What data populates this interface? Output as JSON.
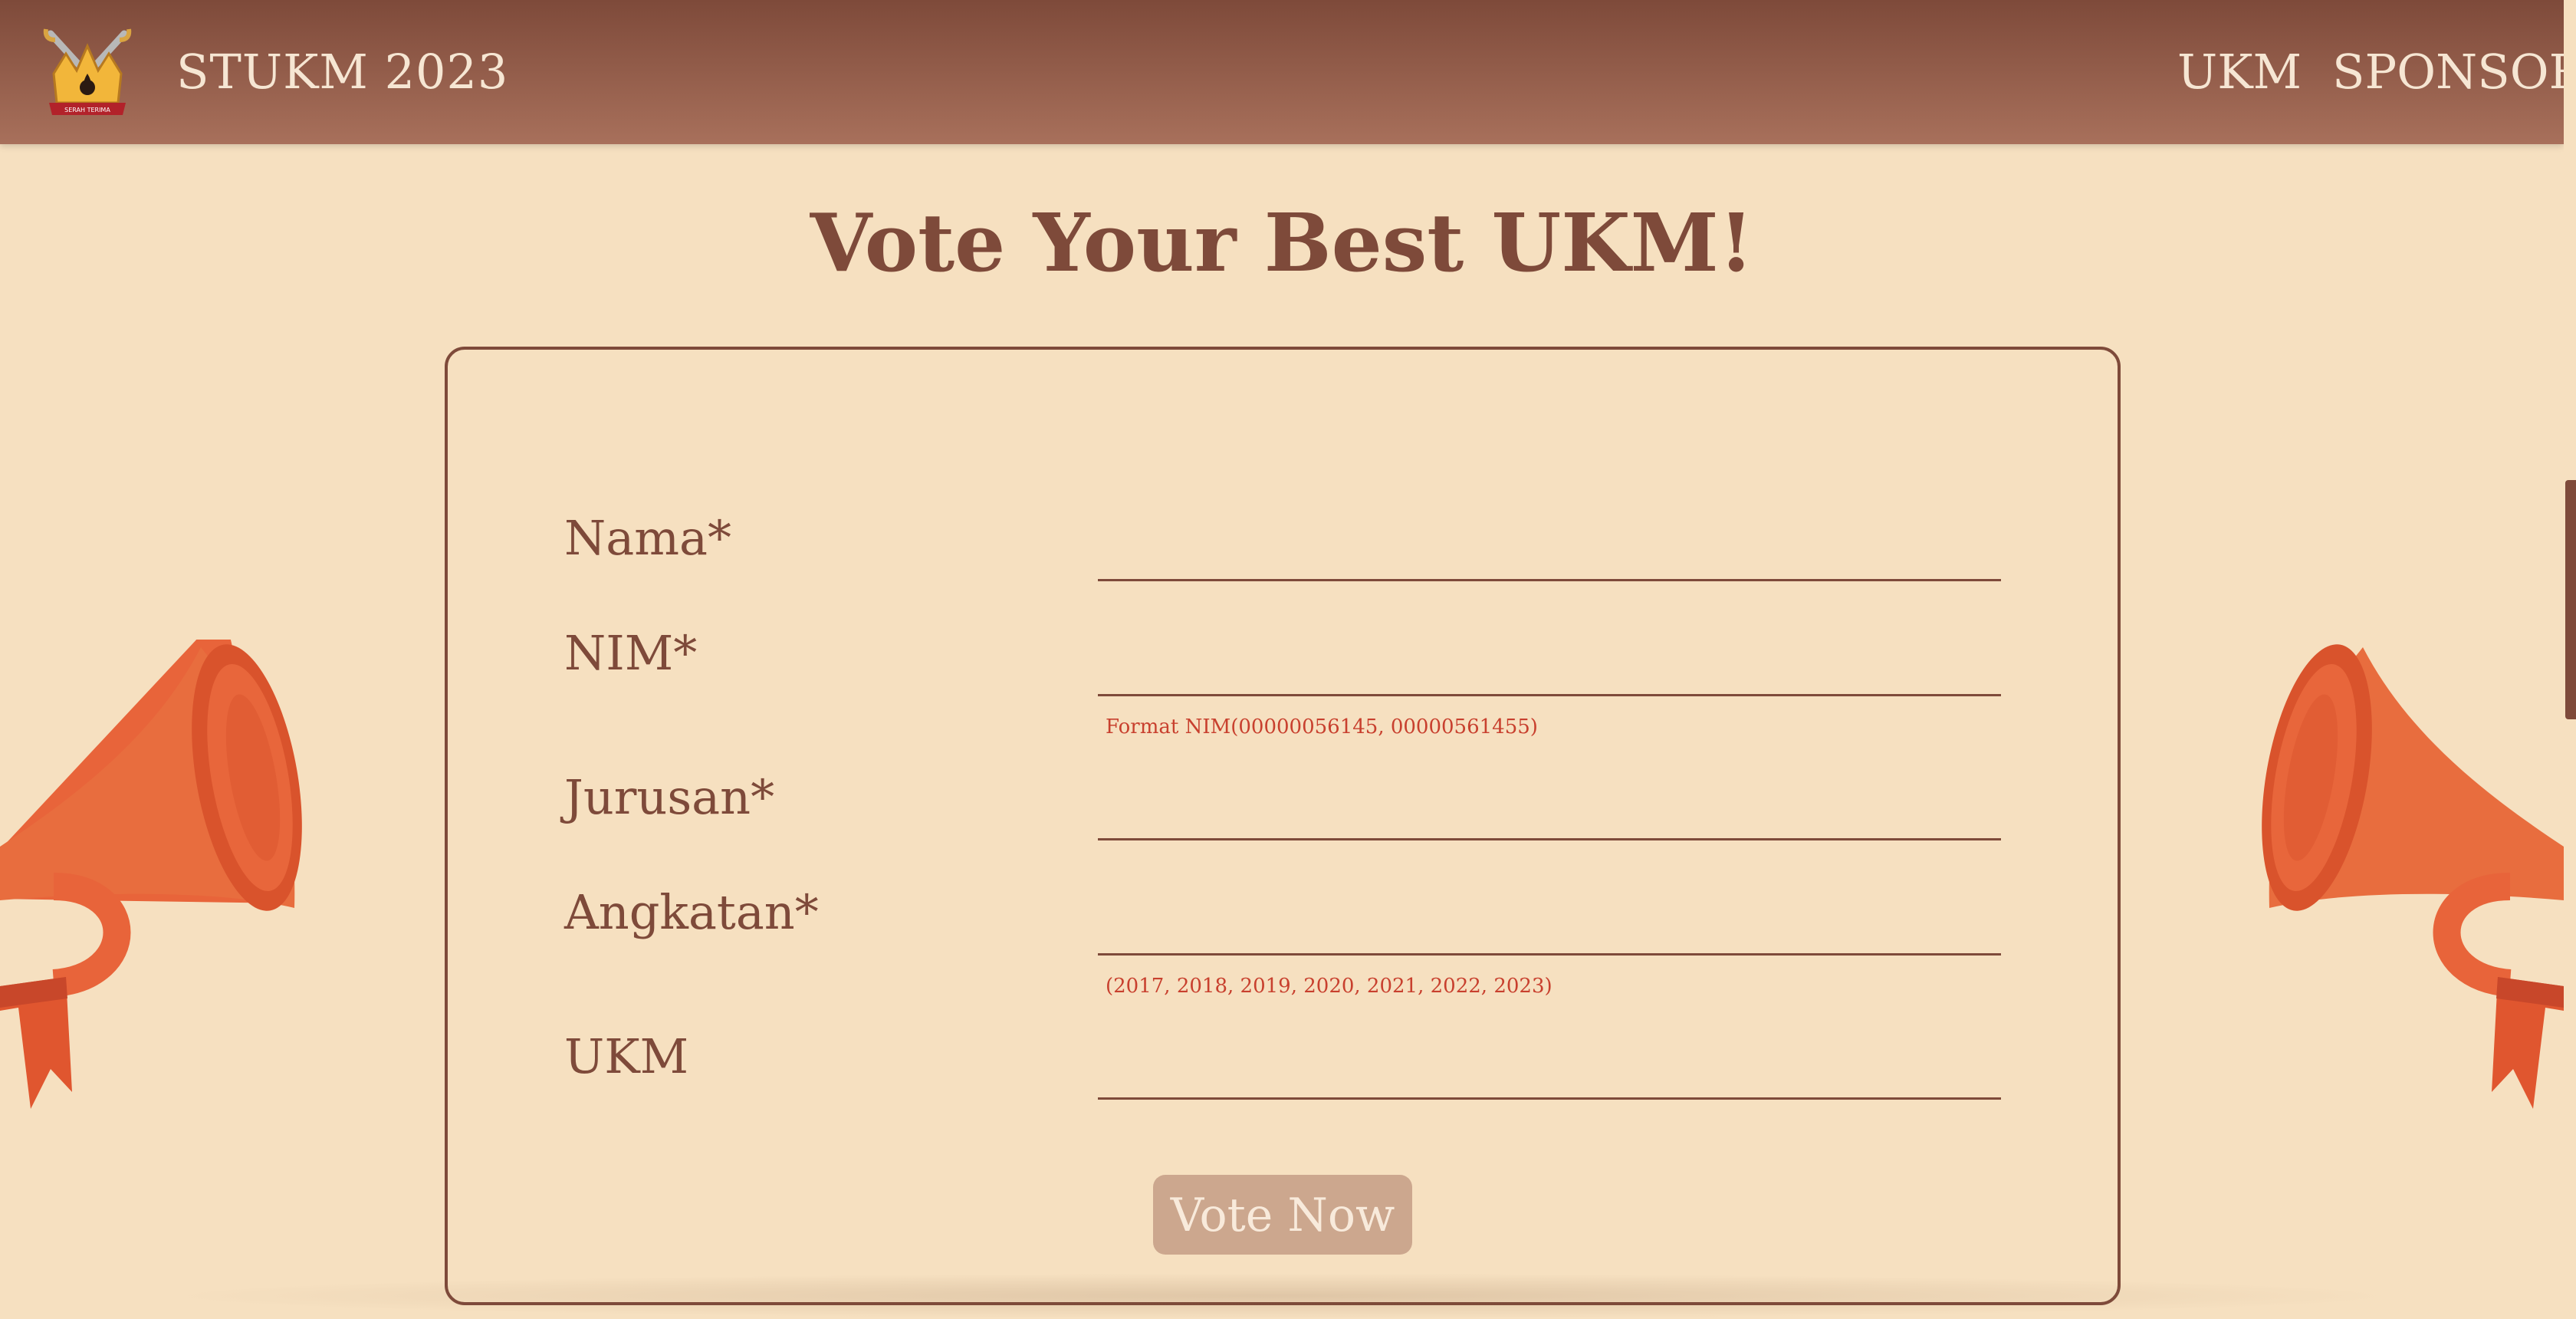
{
  "header": {
    "brand": "STUKM 2023",
    "nav": [
      {
        "label": "UKM"
      },
      {
        "label": "SPONSOR"
      }
    ]
  },
  "page": {
    "title": "Vote Your Best UKM!"
  },
  "form": {
    "fields": [
      {
        "label": "Nama*",
        "value": ""
      },
      {
        "label": "NIM*",
        "value": "",
        "hint": "Format NIM(00000056145, 00000561455)"
      },
      {
        "label": "Jurusan*",
        "value": ""
      },
      {
        "label": "Angkatan*",
        "value": "",
        "hint": "(2017, 2018, 2019, 2020, 2021, 2022, 2023)"
      },
      {
        "label": "UKM",
        "value": ""
      }
    ],
    "submit_label": "Vote Now"
  },
  "colors": {
    "background": "#f6e0c0",
    "header": "#7e4a3a",
    "accent_text": "#7e4a3a",
    "hint_text": "#c8402e",
    "button": "#cca78e",
    "megaphone": "#e8643a"
  },
  "icons": {
    "logo": "crown-swords-logo",
    "decor_left": "megaphone-icon",
    "decor_right": "megaphone-icon"
  }
}
